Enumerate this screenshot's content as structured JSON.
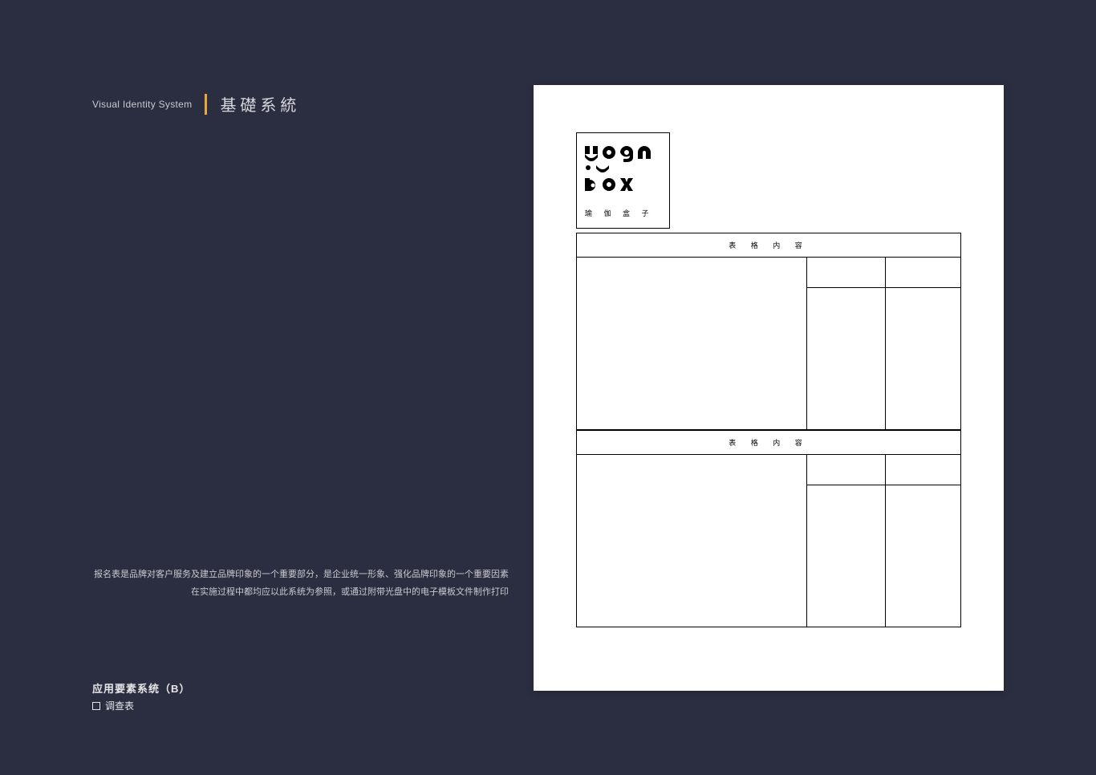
{
  "header": {
    "en": "Visual Identity System",
    "cn": "基礎系統"
  },
  "description": {
    "line1": "报名表是品牌对客户服务及建立品牌印象的一个重要部分，是企业统一形象、强化品牌印象的一个重要因素",
    "line2": "在实施过程中都均应以此系统为参照，或通过附带光盘中的电子模板文件制作打印"
  },
  "footer": {
    "title": "应用要素系统（B）",
    "sub": "调查表"
  },
  "form": {
    "logo_line1": "yoga",
    "logo_line2": "box",
    "logo_sub": "瑜 伽 盒 子",
    "table_header": "表 格 内 容"
  }
}
